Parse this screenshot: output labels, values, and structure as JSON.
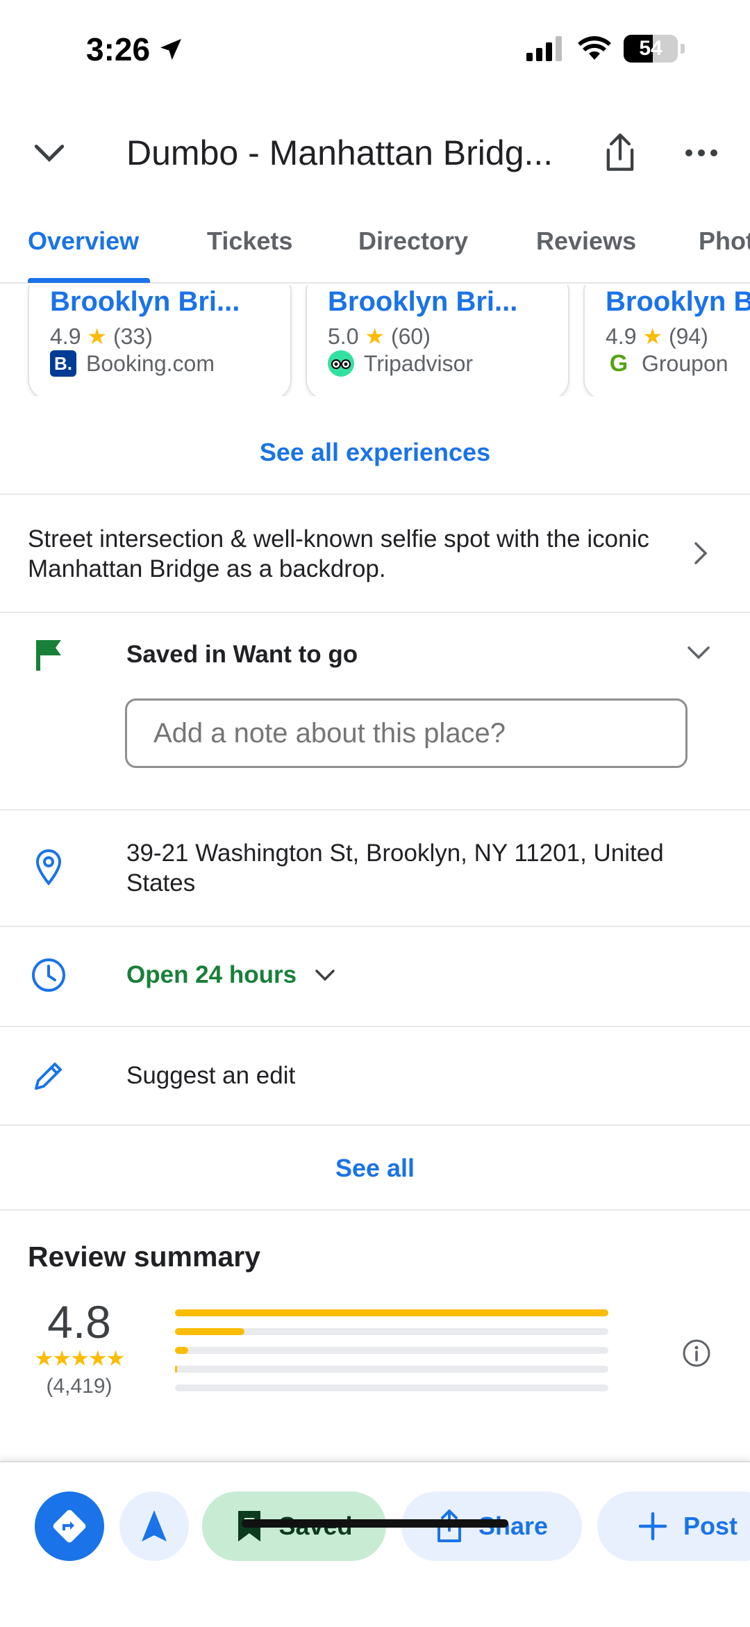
{
  "status_bar": {
    "time": "3:26",
    "battery": "54",
    "battery_level": 0.54
  },
  "header": {
    "title": "Dumbo - Manhattan Bridg..."
  },
  "tabs": [
    {
      "label": "Overview"
    },
    {
      "label": "Tickets"
    },
    {
      "label": "Directory"
    },
    {
      "label": "Reviews"
    },
    {
      "label": "Phot"
    }
  ],
  "experiences": [
    {
      "title": "Brooklyn Bri...",
      "rating": "4.9",
      "count": "(33)",
      "source": "Booking.com",
      "logo": "B."
    },
    {
      "title": "Brooklyn Bri...",
      "rating": "5.0",
      "count": "(60)",
      "source": "Tripadvisor",
      "logo": ""
    },
    {
      "title": "Brooklyn B",
      "rating": "4.9",
      "count": "(94)",
      "source": "Groupon",
      "logo": "G"
    }
  ],
  "see_all_experiences": "See all experiences",
  "description": "Street intersection & well-known selfie spot with the iconic Manhattan Bridge as a backdrop.",
  "saved": {
    "label": "Saved in Want to go",
    "note_placeholder": "Add a note about this place?"
  },
  "address": "39-21 Washington St, Brooklyn, NY 11201, United States",
  "hours": "Open 24 hours",
  "suggest_edit": "Suggest an edit",
  "see_all": "See all",
  "review_summary": {
    "title": "Review summary",
    "rating": "4.8",
    "stars": "★★★★★",
    "count": "(4,419)",
    "distribution": [
      1.0,
      0.16,
      0.03,
      0.005,
      0.0
    ]
  },
  "actions": {
    "saved": "Saved",
    "share": "Share",
    "post": "Post"
  },
  "colors": {
    "accent": "#1a73e8",
    "star": "#fbbc04",
    "open": "#188038",
    "flag": "#188038"
  }
}
